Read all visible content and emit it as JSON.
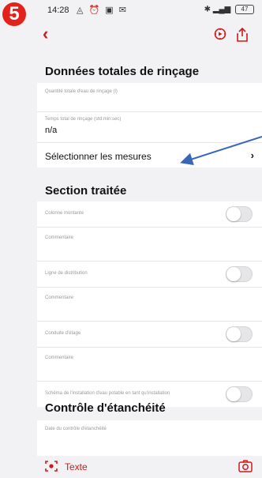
{
  "status_bar": {
    "time": "14:28",
    "battery": "47"
  },
  "annotation": {
    "step_number": "5"
  },
  "sections": {
    "rinse": {
      "title": "Données totales de rinçage",
      "water_quantity_label": "Quantité totale d'eau de rinçage (l)",
      "rinse_time_label": "Temps total de rinçage (std:min:sec)",
      "rinse_time_value": "n/a",
      "select_measures": "Sélectionner les mesures"
    },
    "treated": {
      "title": "Section traitée",
      "comment_label": "Commentaire",
      "items": [
        {
          "label": "Colonne montante"
        },
        {
          "label": "Ligne de distribution"
        },
        {
          "label": "Conduite d'étage"
        },
        {
          "label": "Schéma de l'installation d'eau potable en tant qu'installation"
        }
      ]
    },
    "leak": {
      "title": "Contrôle d'étanchéité",
      "date_label": "Date du contrôle d'étanchéité"
    }
  },
  "bottom_bar": {
    "text_button": "Texte"
  },
  "colors": {
    "accent": "#d21919",
    "badge": "#e3231b",
    "arrow": "#3a66b8"
  }
}
